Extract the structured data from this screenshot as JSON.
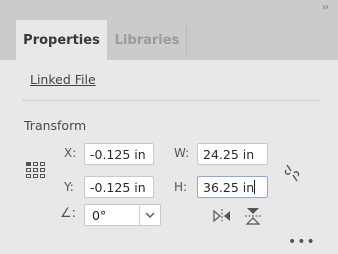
{
  "panel": {
    "collapse_icon": "double-chevron-right-icon",
    "tabs": [
      {
        "label": "Properties",
        "active": true
      },
      {
        "label": "Libraries",
        "active": false
      }
    ],
    "linked_file_label": "Linked File"
  },
  "transform": {
    "title": "Transform",
    "x_label": "X:",
    "x_value": "-0.125 in",
    "y_label": "Y:",
    "y_value": "-0.125 in",
    "w_label": "W:",
    "w_value": "24.25 in",
    "h_label": "H:",
    "h_value": "36.25 in",
    "angle_icon": "angle-icon",
    "angle_value": "0°",
    "constrain_icon": "broken-link-icon",
    "flip_horizontal_icon": "flip-horizontal-icon",
    "flip_vertical_icon": "flip-vertical-icon",
    "more_icon": "more-options-icon"
  }
}
